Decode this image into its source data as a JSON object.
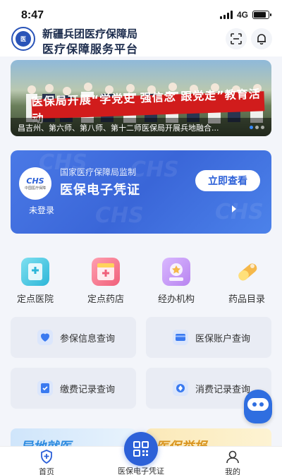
{
  "status_bar": {
    "time": "8:47",
    "network": "4G",
    "battery_level": 0.85
  },
  "header": {
    "subtitle": "新疆兵团医疗保障局",
    "title": "医疗保障服务平台"
  },
  "banner": {
    "slogan": "医保局开展“学党史 强信念 跟党走”教育活动",
    "caption": "昌吉州、第六师、第八师、第十二师医保局开展兵地融合..."
  },
  "card": {
    "badge_text": "CHS",
    "badge_sub": "中国医疗保障",
    "supervised_by": "国家医疗保障局监制",
    "title": "医保电子凭证",
    "action_label": "立即查看",
    "login_status": "未登录"
  },
  "quick_grid": [
    {
      "label": "定点医院",
      "icon": "hospital-icon",
      "color": "#3ec8e0"
    },
    {
      "label": "定点药店",
      "icon": "pharmacy-icon",
      "color": "#f0607a"
    },
    {
      "label": "经办机构",
      "icon": "agency-icon",
      "color": "#b884f0"
    },
    {
      "label": "药品目录",
      "icon": "drug-catalog-icon",
      "color": "#f5b84a"
    }
  ],
  "query_buttons": [
    {
      "label": "参保信息查询",
      "icon": "insurance-info-icon",
      "color": "#3a7af0"
    },
    {
      "label": "医保账户查询",
      "icon": "account-card-icon",
      "color": "#3a7af0"
    },
    {
      "label": "缴费记录查询",
      "icon": "payment-record-icon",
      "color": "#3a7af0"
    },
    {
      "label": "消费记录查询",
      "icon": "consumption-record-icon",
      "color": "#3a7af0"
    }
  ],
  "promos": [
    {
      "text": "异地就医",
      "color": "#2d8be0"
    },
    {
      "text": "医保举报",
      "color": "#d99520"
    }
  ],
  "tabbar": {
    "home": "首页",
    "voucher": "医保电子凭证",
    "mine": "我的"
  },
  "colors": {
    "accent": "#2d61d8",
    "background": "#f3f5fa"
  }
}
